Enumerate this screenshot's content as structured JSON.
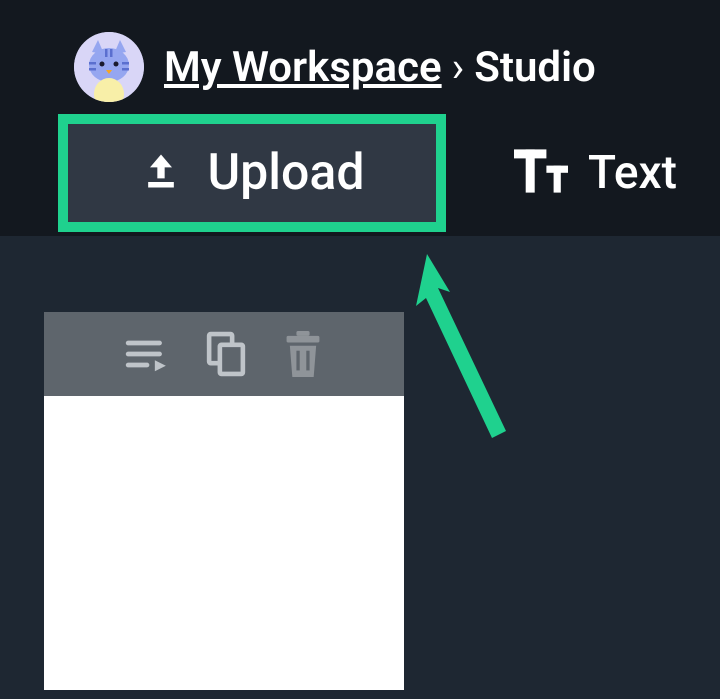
{
  "breadcrumb": {
    "workspace_label": "My Workspace",
    "separator": "›",
    "current_label": "Studio"
  },
  "toolbar": {
    "upload_label": "Upload",
    "text_label": "Text"
  },
  "colors": {
    "accent": "#1fd18e",
    "header_bg": "#13181f",
    "body_bg": "#1e2732",
    "button_bg": "#303844",
    "item_toolbar_bg": "#5e656c"
  }
}
